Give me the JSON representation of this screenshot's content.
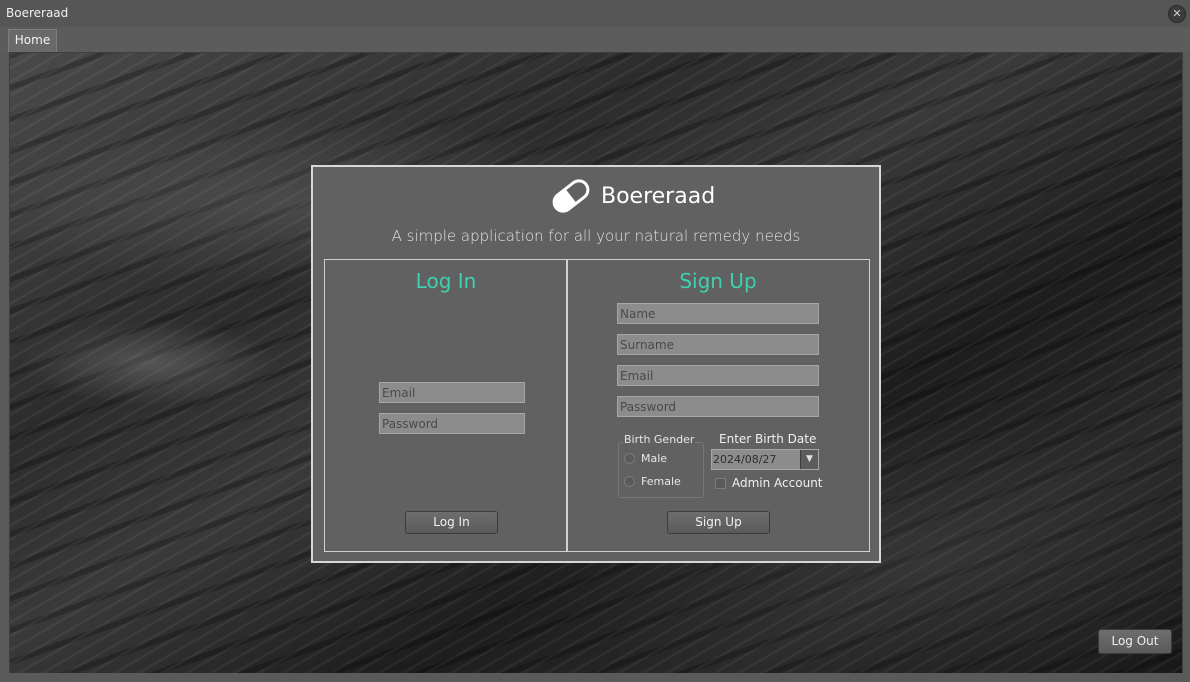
{
  "window": {
    "title": "Boereraad",
    "close_symbol": "✕"
  },
  "tabs": [
    {
      "label": "Home",
      "active": true
    }
  ],
  "brand": {
    "name": "Boereraad",
    "icon": "capsule-pill-icon",
    "tagline": "A simple application for all your natural remedy needs"
  },
  "login": {
    "heading": "Log In",
    "email_placeholder": "Email",
    "password_placeholder": "Password",
    "button_label": "Log In"
  },
  "signup": {
    "heading": "Sign Up",
    "name_placeholder": "Name",
    "surname_placeholder": "Surname",
    "email_placeholder": "Email",
    "password_placeholder": "Password",
    "gender_label": "Birth Gender",
    "gender_options": [
      "Male",
      "Female"
    ],
    "birth_date_label": "Enter Birth Date",
    "birth_date_value": "2024/08/27",
    "dropdown_symbol": "▼",
    "admin_label": "Admin Account",
    "admin_checked": false,
    "button_label": "Sign Up"
  },
  "logout": {
    "label": "Log Out"
  },
  "colors": {
    "accent": "#3ed1b0",
    "panel": "#616161",
    "field": "#8c8c8c",
    "window": "#5a5a5a"
  }
}
